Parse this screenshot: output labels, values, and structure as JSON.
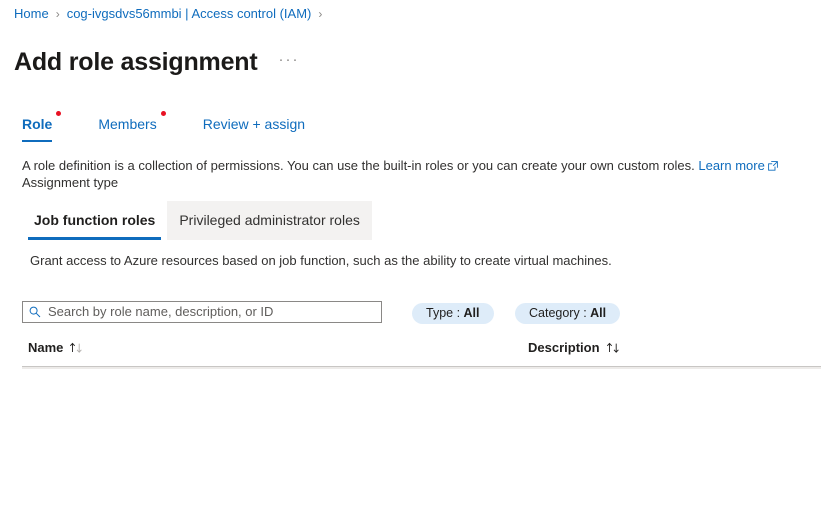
{
  "breadcrumb": {
    "items": [
      {
        "label": "Home"
      },
      {
        "label": "cog-ivgsdvs56mmbi | Access control (IAM)"
      }
    ],
    "separator": "›"
  },
  "header": {
    "title": "Add role assignment",
    "more_options": "···"
  },
  "wizard_tabs": [
    {
      "label": "Role",
      "selected": true,
      "required": true
    },
    {
      "label": "Members",
      "selected": false,
      "required": true
    },
    {
      "label": "Review + assign",
      "selected": false,
      "required": false
    }
  ],
  "description": {
    "text_before_link": "A role definition is a collection of permissions. You can use the built-in roles or you can create your own custom roles. ",
    "link_label": "Learn more",
    "link_icon": "external-link-icon",
    "assignment_type_label": "Assignment type"
  },
  "role_type_pivot": {
    "items": [
      {
        "label": "Job function roles",
        "selected": true
      },
      {
        "label": "Privileged administrator roles",
        "selected": false
      }
    ],
    "description": "Grant access to Azure resources based on job function, such as the ability to create virtual machines."
  },
  "toolbar": {
    "search": {
      "icon": "search-icon",
      "value": "",
      "placeholder": "Search by role name, description, or ID"
    },
    "filters": [
      {
        "name": "Type",
        "separator": " : ",
        "value": "All"
      },
      {
        "name": "Category",
        "separator": " : ",
        "value": "All"
      }
    ]
  },
  "roles_table": {
    "columns": [
      {
        "label": "Name",
        "sortable": true,
        "sort_icon": "sort-ascending-descending-icon"
      },
      {
        "label": "Description",
        "sortable": true,
        "sort_icon": "sort-ascending-descending-icon"
      }
    ],
    "rows": []
  },
  "colors": {
    "accent": "#0f6cbd",
    "required_dot": "#e81123",
    "pill_background": "#deecf9",
    "pivot_inactive_background": "#f3f2f1",
    "text": "#323130",
    "divider": "#c8c6c4"
  }
}
